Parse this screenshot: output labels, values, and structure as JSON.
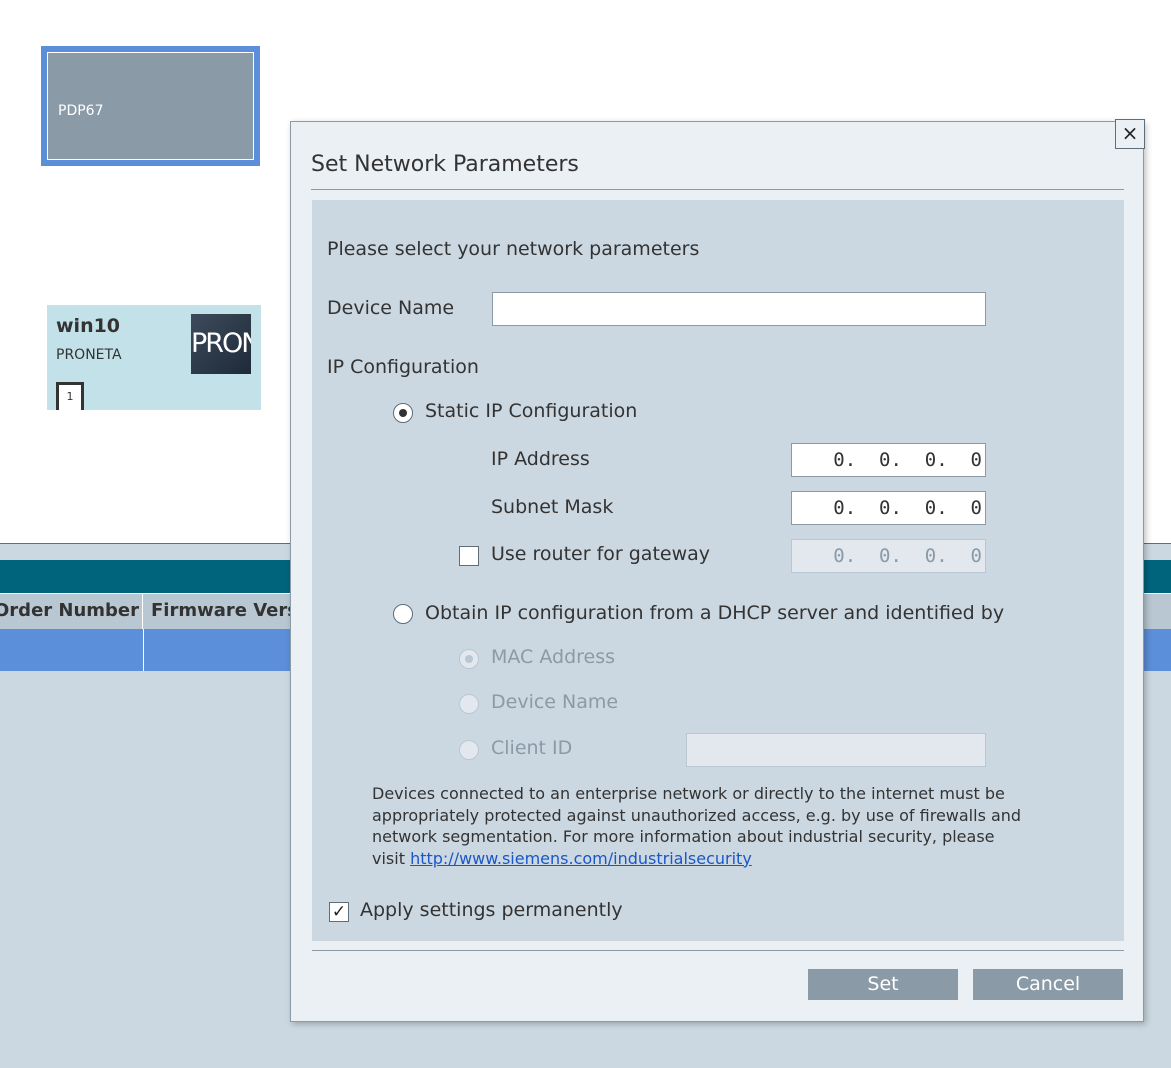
{
  "canvas": {
    "pdp_node": {
      "label": "PDP67"
    },
    "win_node": {
      "title": "win10",
      "subtitle": "PRONETA",
      "logo_text": "PRONETA",
      "port_label": "1"
    }
  },
  "table": {
    "columns": [
      "Order Number",
      "Firmware Version"
    ],
    "selected_row": [
      "",
      ""
    ]
  },
  "dialog": {
    "title": "Set Network Parameters",
    "close_icon": "×",
    "prompt": "Please select your network parameters",
    "device_name": {
      "label": "Device Name",
      "value": ""
    },
    "ip_config_label": "IP Configuration",
    "static": {
      "label": "Static IP Configuration",
      "selected": true,
      "ip_address": {
        "label": "IP Address",
        "value": "0.  0.  0.  0"
      },
      "subnet_mask": {
        "label": "Subnet Mask",
        "value": "0.  0.  0.  0"
      },
      "gateway": {
        "label": "Use router for gateway",
        "checked": false,
        "value": "0.  0.  0.  0"
      }
    },
    "dhcp": {
      "label": "Obtain IP configuration from a DHCP server and identified by",
      "selected": false,
      "options": {
        "mac": "MAC Address",
        "device_name": "Device Name",
        "client_id": "Client ID"
      },
      "client_id_value": ""
    },
    "notice_text": "Devices connected to an enterprise network or directly to the internet must be appropriately protected against unauthorized access, e.g. by use of firewalls and network segmentation. For more information about industrial security, please visit",
    "notice_link": "http://www.siemens.com/industrialsecurity",
    "apply_permanently": {
      "label": "Apply settings permanently",
      "checked": true,
      "check_glyph": "✓"
    },
    "buttons": {
      "set": "Set",
      "cancel": "Cancel"
    }
  }
}
